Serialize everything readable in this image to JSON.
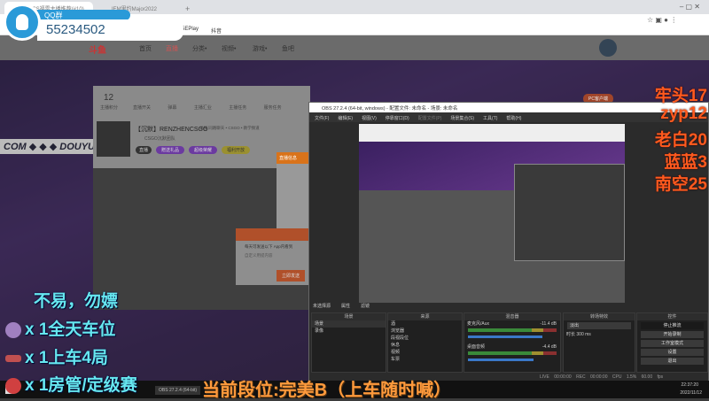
{
  "browser": {
    "tabs": [
      "2022CS福雷主播推荐(#10)",
      "IEM里约Major2022"
    ],
    "new_tab": "+",
    "bookmarks": [
      "5EPlay",
      "抖音"
    ]
  },
  "site": {
    "nav": [
      "首页",
      "直播",
      "分类•",
      "视频•",
      "游戏•",
      "鱼吧"
    ],
    "banner_text": "COM ◆ ◆ ◆ DOUYU.CO"
  },
  "streamer_panel": {
    "score": "12",
    "score_label": "主播积分",
    "icons": [
      "直播开关",
      "弹幕",
      "主播汇业",
      "主播任务",
      "服务任务"
    ],
    "name": "【沉默】RENZHENCSGO",
    "tags": "举报  同路聊天 • CSGO • 教学频道",
    "badge_row": "CSGO沉默团队",
    "buttons": [
      "直播",
      "赠送礼品",
      "超级荣耀",
      "福利开放"
    ],
    "pc_button": "PC客户端"
  },
  "dialog": {
    "title": "直播信息",
    "hint": "每天可发送以下 App内看到",
    "input": "自定义用提内容",
    "button": "立即发送"
  },
  "qq_badge": {
    "label": "QQ群",
    "number": "55234502"
  },
  "obs": {
    "title": "OBS 27.2.4 (64-bit, windows) - 配置文件: 未命名 - 场景: 未命名",
    "menu": [
      "文件(F)",
      "编辑(E)",
      "视图(V)",
      "停靠窗口(D)",
      "配置文件(P)",
      "场景集合(S)",
      "工具(T)",
      "帮助(H)"
    ],
    "source_bar": [
      "未选择源",
      "属性",
      "滤镜"
    ],
    "scenes_header": "场景",
    "scenes": [
      "场景",
      "录像"
    ],
    "sources_header": "来源",
    "sources": [
      "酒",
      "浏览器",
      "段视段位",
      "休息",
      "视频",
      "车票"
    ],
    "mixer_header": "混音器",
    "mixer": [
      {
        "name": "麦克风/Aux",
        "db": "-11.4 dB",
        "level": 0.72
      },
      {
        "name": "桌面音频",
        "db": "-4.4 dB",
        "level": 0.8
      }
    ],
    "transition_header": "转场特效",
    "transition": "淡出",
    "duration_label": "时长",
    "duration": "300 ms",
    "controls_header": "控件",
    "controls": [
      "停止推流",
      "开始录制",
      "工作室模式",
      "设置",
      "退出"
    ],
    "status": "LIVE 00:00:00  REC 00:00:00  CPU 1.5% 60.00 fps"
  },
  "overlay": {
    "left_lines": [
      "不易，勿嫖",
      "x 1全天车位",
      "x 1上车4局",
      "x 1房管/定级赛"
    ],
    "bottom": "当前段位:完美B（上车随时喊）",
    "ranks": [
      "牢头17",
      "zyp12",
      "老白20",
      "蓝蓝3",
      "南空25"
    ]
  },
  "taskbar": {
    "obs_item": "OBS 27.2.4 (64-bit)",
    "time": "22:37:20",
    "date": "2022/11/12"
  }
}
